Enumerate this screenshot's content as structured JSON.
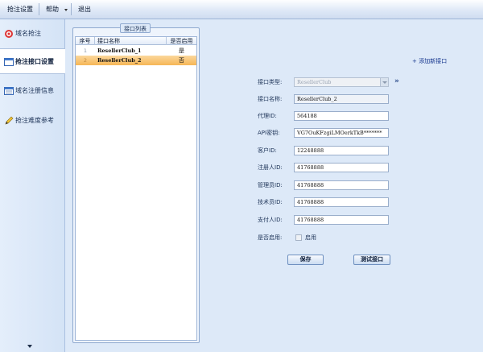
{
  "menubar": {
    "items": [
      "抢注设置",
      "帮助",
      "退出"
    ]
  },
  "sidebar": {
    "items": [
      {
        "label": "域名抢注",
        "icon": "target-icon"
      },
      {
        "label": "抢注接口设置",
        "icon": "window-icon",
        "active": true
      },
      {
        "label": "域名注册信息",
        "icon": "form-icon"
      },
      {
        "label": "抢注难度参考",
        "icon": "pencil-icon"
      }
    ]
  },
  "list": {
    "group_title": "接口列表",
    "columns": [
      "序号",
      "接口名称",
      "是否启用"
    ],
    "rows": [
      {
        "index": "1",
        "name": "ResellerClub_1",
        "enabled": "是"
      },
      {
        "index": "2",
        "name": "ResellerClub_2",
        "enabled": "否"
      }
    ]
  },
  "add_link": "+ 添加新接口",
  "form": {
    "type_label": "接口类型:",
    "type_value": "ResellerClub",
    "name_label": "接口名称:",
    "name_value": "ResellerClub_2",
    "proxy_label": "代理ID:",
    "proxy_value": "564188",
    "api_label": "API密钥:",
    "api_value": "VG7OuKFzgiLMOerkTkB*******",
    "client_label": "客户ID:",
    "client_value": "12248888",
    "registrant_label": "注册人ID:",
    "registrant_value": "41768888",
    "admin_label": "管理员ID:",
    "admin_value": "41768888",
    "tech_label": "技术员ID:",
    "tech_value": "41768888",
    "billing_label": "支付人ID:",
    "billing_value": "41768888",
    "enabled_label": "是否启用:",
    "enabled_checkbox_label": "启用",
    "more_icon": "»",
    "save_button": "保存",
    "test_button": "测试接口"
  }
}
